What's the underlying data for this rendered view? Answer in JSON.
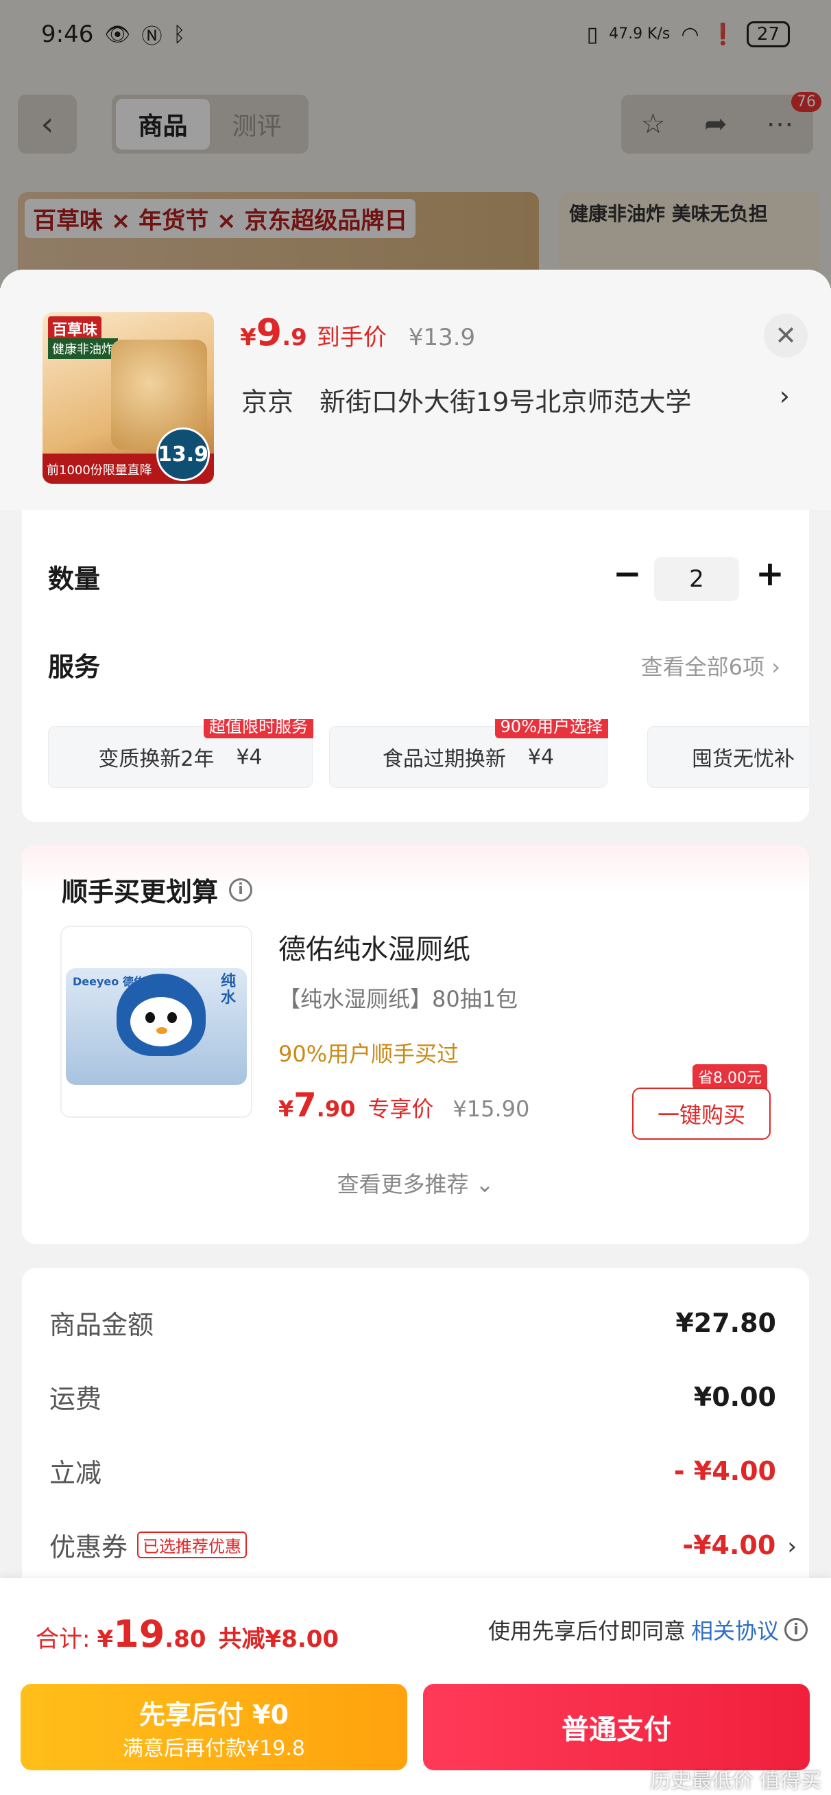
{
  "status_bar": {
    "time": "9:46",
    "speed": "47.9 K/s",
    "battery": "27"
  },
  "nav": {
    "tabs": [
      {
        "label": "商品"
      },
      {
        "label": "测评"
      }
    ],
    "badge": "76"
  },
  "banner": {
    "brand": "百草味 × 年货节 × 京东超级品牌日",
    "right_text": "健康非油炸 美味无负担"
  },
  "product": {
    "thumb_brand": "百草味",
    "thumb_tag": "健康非油炸",
    "thumb_footer": "前1000份限量直降",
    "thumb_price": "13.9",
    "price_symbol": "¥",
    "price_int": "9",
    "price_dec": ".9",
    "price_label": "到手价",
    "orig_price": "¥13.9",
    "address": "京京　新街口外大街19号北京师范大学",
    "address_chevron": "›"
  },
  "options": {
    "qty_label": "数量",
    "qty_value": "2",
    "minus": "−",
    "plus": "+",
    "service_label": "服务",
    "service_all": "查看全部6项 ›",
    "services": [
      {
        "name": "变质换新2年",
        "price": "¥4",
        "badge": "超值限时服务"
      },
      {
        "name": "食品过期换新",
        "price": "¥4",
        "badge": "90%用户选择"
      },
      {
        "name": "囤货无忧补",
        "price": "",
        "badge": ""
      }
    ]
  },
  "recommend": {
    "title": "顺手买更划算",
    "info": "i",
    "item": {
      "logo": "Deeyeo 德佑",
      "pack_text": "纯水",
      "name": "德佑纯水湿厕纸",
      "spec": "【纯水湿厕纸】80抽1包",
      "social": "90%用户顺手买过",
      "price_symbol": "¥",
      "price_int": "7",
      "price_dec": ".90",
      "price_label": "专享价",
      "orig_price": "¥15.90",
      "save_badge": "省8.00元",
      "buy_label": "一键购买"
    },
    "more": "查看更多推荐 ⌄"
  },
  "summary": {
    "rows": [
      {
        "label": "商品金额",
        "value": "¥27.80"
      },
      {
        "label": "运费",
        "value": "¥0.00"
      },
      {
        "label": "立减",
        "value": "- ¥4.00"
      },
      {
        "label": "优惠券",
        "value": "-¥4.00",
        "tag": "已选推荐优惠"
      }
    ]
  },
  "footer": {
    "total_label": "合计:",
    "total_symbol": "¥",
    "total_int": "19",
    "total_dec": ".80",
    "total_save": "共减¥8.00",
    "agree_text": "使用先享后付即同意",
    "agree_link": "相关协议",
    "later_title": "先享后付 ¥0",
    "later_sub": "满意后再付款¥19.8",
    "pay_label": "普通支付",
    "watermark": "历史最低价 值得买"
  },
  "colors": {
    "accent_red": "#e02727",
    "later_yellow": "#ffb214",
    "pay_red": "#f0203c",
    "link_blue": "#2f6ec3"
  }
}
